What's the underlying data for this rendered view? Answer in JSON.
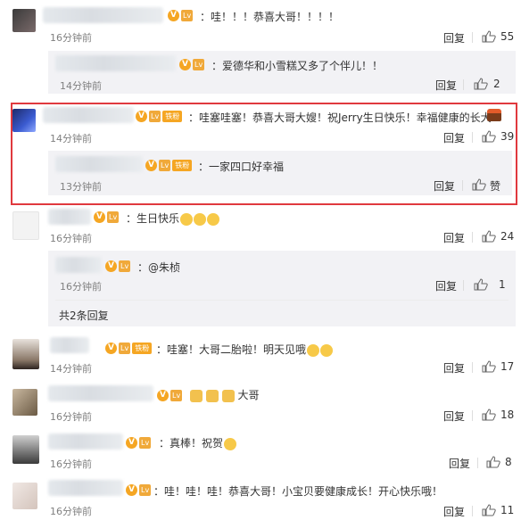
{
  "comments": [
    {
      "id": "c1",
      "text": "：哇！！！恭喜大哥！！！！",
      "time": "16分钟前",
      "reply": "回复",
      "likes": "55"
    },
    {
      "id": "r1",
      "text": "：爱德华和小雪糕又多了个伴儿！！",
      "time": "14分钟前",
      "reply": "回复",
      "likes": "2"
    },
    {
      "id": "c2",
      "badge": "铁粉",
      "text": "：哇塞哇塞！恭喜大哥大嫂！祝Jerry生日快乐！幸福健康的长大",
      "time": "14分钟前",
      "reply": "回复",
      "likes": "39"
    },
    {
      "id": "r2",
      "badge": "铁粉",
      "text": "：一家四口好幸福",
      "time": "13分钟前",
      "reply": "回复",
      "likes": "赞"
    },
    {
      "id": "c3",
      "text": "：生日快乐",
      "time": "16分钟前",
      "reply": "回复",
      "likes": "24"
    },
    {
      "id": "r3",
      "text": "：@朱桢",
      "time": "16分钟前",
      "reply": "回复",
      "likes": "1",
      "more": "共2条回复"
    },
    {
      "id": "c4",
      "badge": "铁粉",
      "text": "：哇塞！大哥二胎啦！明天见哦",
      "time": "14分钟前",
      "reply": "回复",
      "likes": "17"
    },
    {
      "id": "c5",
      "text": "大哥",
      "time": "16分钟前",
      "reply": "回复",
      "likes": "18"
    },
    {
      "id": "c6",
      "text": "：真棒！祝贺",
      "time": "16分钟前",
      "reply": "回复",
      "likes": "8"
    },
    {
      "id": "c7",
      "text": "：哇！哇！哇！恭喜大哥！小宝贝要健康成长！开心快乐哦！",
      "time": "16分钟前",
      "reply": "回复",
      "likes": "11"
    }
  ],
  "icons": {
    "like": "thumbs-up-icon",
    "verified": "v-badge-icon",
    "level": "level-badge-icon"
  },
  "colors": {
    "highlight_border": "#e0393e",
    "badge": "#f5a623",
    "muted": "#808080"
  },
  "badges": {
    "v": "V",
    "level": "Lv",
    "fan": "铁粉"
  }
}
